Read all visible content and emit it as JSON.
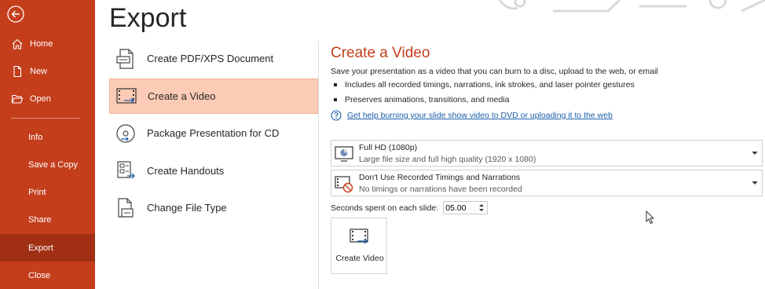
{
  "sidebar": {
    "items": [
      {
        "label": "Home",
        "icon": "home-icon"
      },
      {
        "label": "New",
        "icon": "new-document-icon"
      },
      {
        "label": "Open",
        "icon": "folder-open-icon"
      },
      {
        "label": "Info"
      },
      {
        "label": "Save a Copy"
      },
      {
        "label": "Print"
      },
      {
        "label": "Share"
      },
      {
        "label": "Export",
        "active": true
      },
      {
        "label": "Close"
      }
    ],
    "accent": "#c43e1c",
    "active_color": "#a02f13"
  },
  "page": {
    "title": "Export"
  },
  "export_options": [
    {
      "label": "Create PDF/XPS Document",
      "icon": "pdf-document-icon"
    },
    {
      "label": "Create a Video",
      "icon": "video-filmstrip-icon",
      "selected": true
    },
    {
      "label": "Package Presentation for CD",
      "icon": "cd-package-icon"
    },
    {
      "label": "Create Handouts",
      "icon": "handouts-icon"
    },
    {
      "label": "Change File Type",
      "icon": "change-file-type-icon"
    }
  ],
  "video": {
    "title": "Create a Video",
    "description": "Save your presentation as a video that you can burn to a disc, upload to the web, or email",
    "bullets": [
      "Includes all recorded timings, narrations, ink strokes, and laser pointer gestures",
      "Preserves animations, transitions, and media"
    ],
    "help_link": "Get help burning your slide show video to DVD or uploading it to the web",
    "quality": {
      "selected": "Full HD (1080p)",
      "detail": "Large file size and full high quality (1920 x 1080)"
    },
    "timings": {
      "selected": "Don't Use Recorded Timings and Narrations",
      "detail": "No timings or narrations have been recorded"
    },
    "seconds_label": "Seconds spent on each slide:",
    "seconds_value": "05.00",
    "create_button": "Create Video"
  }
}
